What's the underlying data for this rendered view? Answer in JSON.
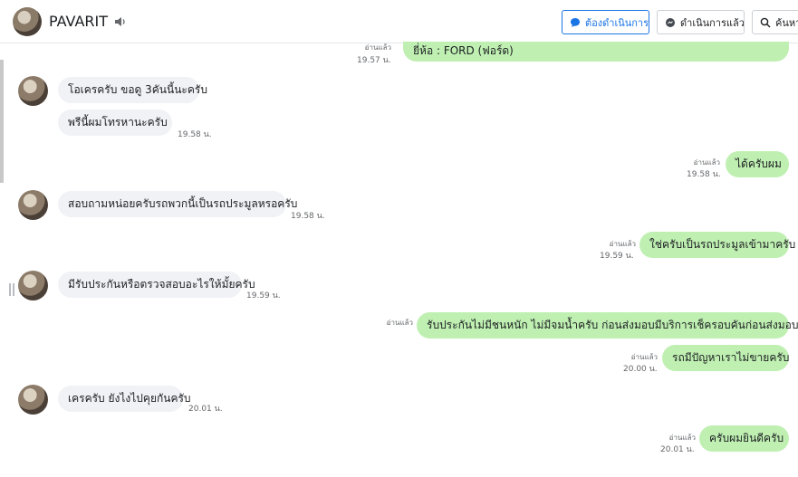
{
  "header": {
    "name": "PAVARIT",
    "btn_pending": "ต้องดำเนินการ",
    "btn_done": "ดำเนินการแล้ว",
    "btn_search": "ค้นหา"
  },
  "messages": [
    {
      "dir": "out",
      "text": "ยี่ห้อ : FORD (ฟอร์ด)",
      "read": "อ่านแล้ว",
      "time": "19.57 น."
    },
    {
      "dir": "in",
      "text": "โอเครครับ ขอดู 3คันนี้นะครับ"
    },
    {
      "dir": "in",
      "text": "พรีนี้ผมโทรหานะครับ",
      "time": "19.58 น."
    },
    {
      "dir": "out",
      "text": "ได้ครับผม",
      "read": "อ่านแล้ว",
      "time": "19.58 น."
    },
    {
      "dir": "in",
      "text": "สอบถามหน่อยครับรถพวกนี้เป็นรถประมูลหรอครับ",
      "time": "19.58 น."
    },
    {
      "dir": "out",
      "text": "ใช่ครับเป็นรถประมูลเข้ามาครับ",
      "read": "อ่านแล้ว",
      "time": "19.59 น."
    },
    {
      "dir": "in",
      "text": "มีรับประกันหรือตรวจสอบอะไรให้มั้ยครับ",
      "time": "19.59 น."
    },
    {
      "dir": "out",
      "text": "รับประกันไม่มีชนหนัก ไม่มีจมน้ำครับ ก่อนส่งมอบมีบริการเช็ครอบคันก่อนส่งมอบครับ",
      "read": "อ่านแล้ว"
    },
    {
      "dir": "out",
      "text": "รถมีปัญหาเราไม่ขายครับ",
      "read": "อ่านแล้ว",
      "time": "20.00 น."
    },
    {
      "dir": "in",
      "text": "เครครับ ยังไงไปคุยกันครับ",
      "time": "20.01 น."
    },
    {
      "dir": "out",
      "text": "ครับผมยินดีครับ",
      "read": "อ่านแล้ว",
      "time": "20.01 น."
    }
  ]
}
